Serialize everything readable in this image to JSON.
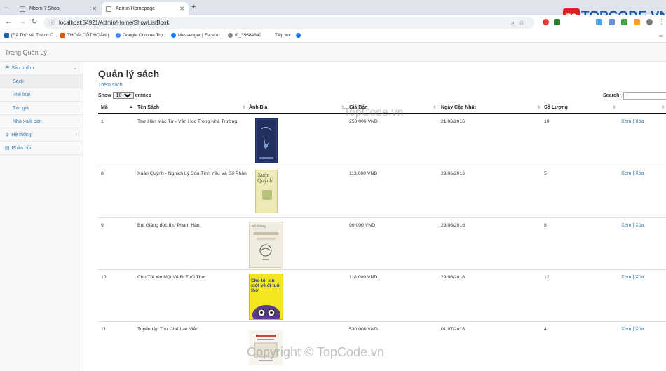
{
  "browser": {
    "tabs": [
      {
        "title": "Nhom 7 Shop",
        "active": false
      },
      {
        "title": "Admin Homepage",
        "active": true
      }
    ],
    "url": "localhost:54921/Admin/Home/ShowListBook",
    "bookmarks": [
      {
        "label": "[Đã Thử Và Thành C...",
        "icon": "blue-square-icon"
      },
      {
        "label": "THOẢI CỐT HOÀN |...",
        "icon": "shop-bag-icon"
      },
      {
        "label": "Google Chrome Trợ...",
        "icon": "google-icon"
      },
      {
        "label": "Messenger | Facebo...",
        "icon": "facebook-icon"
      },
      {
        "label": "f0_35684640",
        "icon": "globe-icon"
      },
      {
        "label": "Tiếp tục",
        "icon": ""
      }
    ]
  },
  "watermark": {
    "logo_text": "TOPCODE.VN",
    "overlay_1": "TopCode.vn",
    "overlay_2": "Copyright © TopCode.vn"
  },
  "app": {
    "brand": "Trang Quản Lý",
    "sidebar": {
      "sections": [
        {
          "label": "Sản phẩm",
          "icon": "list-icon",
          "expanded": true,
          "items": [
            "Sách",
            "Thể loại",
            "Tác giả",
            "Nhà xuất bản"
          ]
        },
        {
          "label": "Hệ thống",
          "icon": "gears-icon",
          "expanded": false
        },
        {
          "label": "Phản hồi",
          "icon": "file-icon",
          "expanded": false
        }
      ]
    },
    "main": {
      "title": "Quản lý sách",
      "add_link": "Thêm sách",
      "length": {
        "prefix": "Show",
        "value": "10",
        "suffix": "entries"
      },
      "search_label": "Search:",
      "columns": [
        "Mã",
        "Tên Sách",
        "Ảnh Bìa",
        "Giá Bán",
        "Ngày Cập Nhật",
        "Số Lượng",
        ""
      ],
      "rows": [
        {
          "id": "1",
          "name": "Thơ Hàn Mặc Tử - Văn Học Trong Nhà Trường",
          "price": "250,000 VND",
          "date": "21/06/2016",
          "qty": "10",
          "view": "Xem",
          "del": "Xóa"
        },
        {
          "id": "8",
          "name": "Xuân Quỳnh - Nghịch Lý Của Tình Yêu Và Số Phận",
          "price": "113,000 VND",
          "date": "29/06/2016",
          "qty": "5",
          "view": "Xem",
          "del": "Xóa"
        },
        {
          "id": "9",
          "name": "Bùi Giáng đọc thơ Phạm Hầu",
          "price": "90,000 VND",
          "date": "29/06/2016",
          "qty": "8",
          "view": "Xem",
          "del": "Xóa"
        },
        {
          "id": "10",
          "name": "Cho Tôi Xin Một Vé Đi Tuổi Thơ",
          "price": "118,000 VND",
          "date": "29/06/2016",
          "qty": "12",
          "view": "Xem",
          "del": "Xóa"
        },
        {
          "id": "11",
          "name": "Tuyển tập Thơ Chế Lan Viên",
          "price": "530,000 VND",
          "date": "01/07/2016",
          "qty": "4",
          "view": "Xem",
          "del": "Xóa"
        }
      ],
      "cover_texts": {
        "c2": "Xuân Quỳnh",
        "c3": "Bùi Giáng",
        "c4": "Cho tôi xin một vé đi tuổi thơ"
      }
    }
  }
}
